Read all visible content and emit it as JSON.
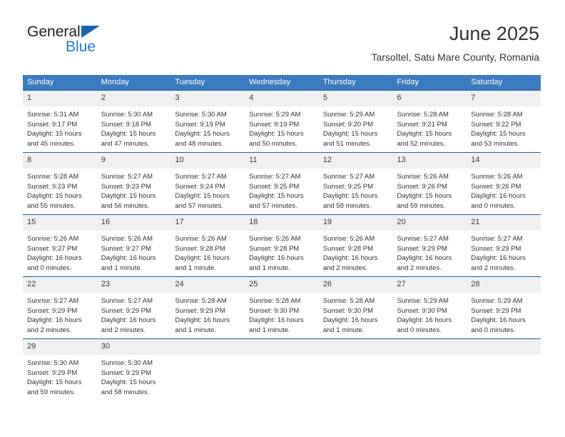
{
  "brand": {
    "name_part1": "General",
    "name_part2": "Blue",
    "triangle_icon": "triangle-icon",
    "accent_dark_blue": "#1866b0",
    "accent_blue": "#1f7ad4"
  },
  "header": {
    "month_title": "June 2025",
    "location": "Tarsoltel, Satu Mare County, Romania"
  },
  "theme": {
    "header_row_bg": "#3a7cbe",
    "row_separator": "#1f5fa3",
    "daynum_bg": "#f0f0f0",
    "text": "#333333"
  },
  "calendar": {
    "weekday_headers": [
      "Sunday",
      "Monday",
      "Tuesday",
      "Wednesday",
      "Thursday",
      "Friday",
      "Saturday"
    ],
    "weeks": [
      [
        {
          "day": "1",
          "info": "Sunrise: 5:31 AM\nSunset: 9:17 PM\nDaylight: 15 hours\nand 45 minutes."
        },
        {
          "day": "2",
          "info": "Sunrise: 5:30 AM\nSunset: 9:18 PM\nDaylight: 15 hours\nand 47 minutes."
        },
        {
          "day": "3",
          "info": "Sunrise: 5:30 AM\nSunset: 9:19 PM\nDaylight: 15 hours\nand 48 minutes."
        },
        {
          "day": "4",
          "info": "Sunrise: 5:29 AM\nSunset: 9:19 PM\nDaylight: 15 hours\nand 50 minutes."
        },
        {
          "day": "5",
          "info": "Sunrise: 5:29 AM\nSunset: 9:20 PM\nDaylight: 15 hours\nand 51 minutes."
        },
        {
          "day": "6",
          "info": "Sunrise: 5:28 AM\nSunset: 9:21 PM\nDaylight: 15 hours\nand 52 minutes."
        },
        {
          "day": "7",
          "info": "Sunrise: 5:28 AM\nSunset: 9:22 PM\nDaylight: 15 hours\nand 53 minutes."
        }
      ],
      [
        {
          "day": "8",
          "info": "Sunrise: 5:28 AM\nSunset: 9:23 PM\nDaylight: 15 hours\nand 55 minutes."
        },
        {
          "day": "9",
          "info": "Sunrise: 5:27 AM\nSunset: 9:23 PM\nDaylight: 15 hours\nand 56 minutes."
        },
        {
          "day": "10",
          "info": "Sunrise: 5:27 AM\nSunset: 9:24 PM\nDaylight: 15 hours\nand 57 minutes."
        },
        {
          "day": "11",
          "info": "Sunrise: 5:27 AM\nSunset: 9:25 PM\nDaylight: 15 hours\nand 57 minutes."
        },
        {
          "day": "12",
          "info": "Sunrise: 5:27 AM\nSunset: 9:25 PM\nDaylight: 15 hours\nand 58 minutes."
        },
        {
          "day": "13",
          "info": "Sunrise: 5:26 AM\nSunset: 9:26 PM\nDaylight: 15 hours\nand 59 minutes."
        },
        {
          "day": "14",
          "info": "Sunrise: 5:26 AM\nSunset: 9:26 PM\nDaylight: 16 hours\nand 0 minutes."
        }
      ],
      [
        {
          "day": "15",
          "info": "Sunrise: 5:26 AM\nSunset: 9:27 PM\nDaylight: 16 hours\nand 0 minutes."
        },
        {
          "day": "16",
          "info": "Sunrise: 5:26 AM\nSunset: 9:27 PM\nDaylight: 16 hours\nand 1 minute."
        },
        {
          "day": "17",
          "info": "Sunrise: 5:26 AM\nSunset: 9:28 PM\nDaylight: 16 hours\nand 1 minute."
        },
        {
          "day": "18",
          "info": "Sunrise: 5:26 AM\nSunset: 9:28 PM\nDaylight: 16 hours\nand 1 minute."
        },
        {
          "day": "19",
          "info": "Sunrise: 5:26 AM\nSunset: 9:28 PM\nDaylight: 16 hours\nand 2 minutes."
        },
        {
          "day": "20",
          "info": "Sunrise: 5:27 AM\nSunset: 9:29 PM\nDaylight: 16 hours\nand 2 minutes."
        },
        {
          "day": "21",
          "info": "Sunrise: 5:27 AM\nSunset: 9:29 PM\nDaylight: 16 hours\nand 2 minutes."
        }
      ],
      [
        {
          "day": "22",
          "info": "Sunrise: 5:27 AM\nSunset: 9:29 PM\nDaylight: 16 hours\nand 2 minutes."
        },
        {
          "day": "23",
          "info": "Sunrise: 5:27 AM\nSunset: 9:29 PM\nDaylight: 16 hours\nand 2 minutes."
        },
        {
          "day": "24",
          "info": "Sunrise: 5:28 AM\nSunset: 9:29 PM\nDaylight: 16 hours\nand 1 minute."
        },
        {
          "day": "25",
          "info": "Sunrise: 5:28 AM\nSunset: 9:30 PM\nDaylight: 16 hours\nand 1 minute."
        },
        {
          "day": "26",
          "info": "Sunrise: 5:28 AM\nSunset: 9:30 PM\nDaylight: 16 hours\nand 1 minute."
        },
        {
          "day": "27",
          "info": "Sunrise: 5:29 AM\nSunset: 9:30 PM\nDaylight: 16 hours\nand 0 minutes."
        },
        {
          "day": "28",
          "info": "Sunrise: 5:29 AM\nSunset: 9:29 PM\nDaylight: 16 hours\nand 0 minutes."
        }
      ],
      [
        {
          "day": "29",
          "info": "Sunrise: 5:30 AM\nSunset: 9:29 PM\nDaylight: 15 hours\nand 59 minutes."
        },
        {
          "day": "30",
          "info": "Sunrise: 5:30 AM\nSunset: 9:29 PM\nDaylight: 15 hours\nand 58 minutes."
        },
        {
          "day": "",
          "info": ""
        },
        {
          "day": "",
          "info": ""
        },
        {
          "day": "",
          "info": ""
        },
        {
          "day": "",
          "info": ""
        },
        {
          "day": "",
          "info": ""
        }
      ]
    ]
  }
}
